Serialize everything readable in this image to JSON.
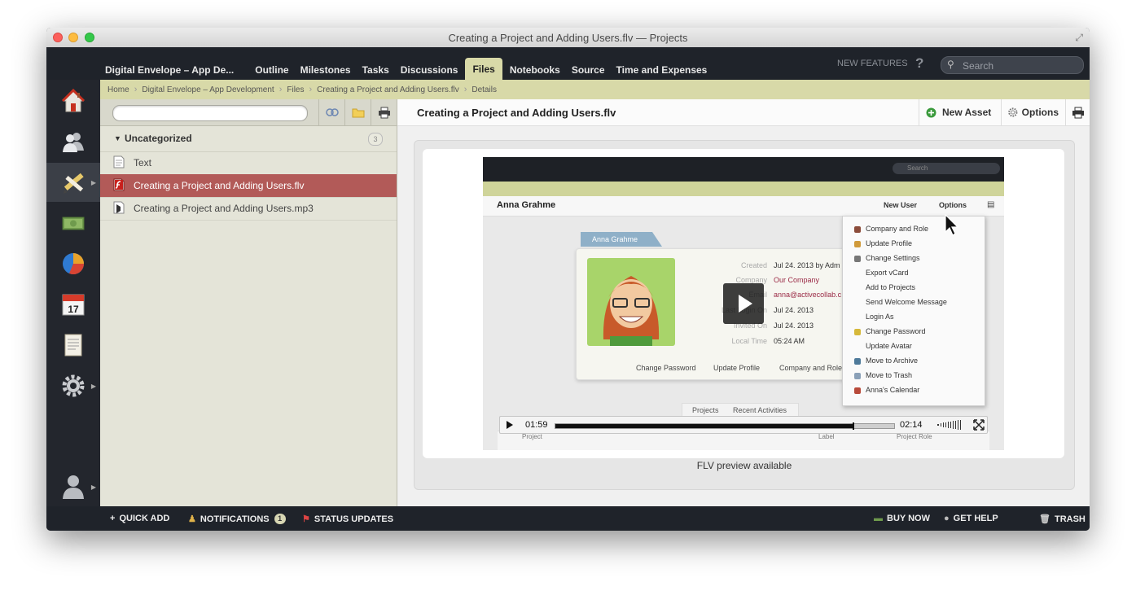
{
  "window": {
    "title": "Creating a Project and Adding Users.flv — Projects"
  },
  "topnav": {
    "tabs": [
      {
        "label": "Digital Envelope – App De..."
      },
      {
        "label": "Outline"
      },
      {
        "label": "Milestones"
      },
      {
        "label": "Tasks"
      },
      {
        "label": "Discussions"
      },
      {
        "label": "Files"
      },
      {
        "label": "Notebooks"
      },
      {
        "label": "Source"
      },
      {
        "label": "Time and Expenses"
      }
    ],
    "active_tab": "Files",
    "new_features": "NEW FEATURES",
    "help": "?",
    "search_placeholder": "Search"
  },
  "leftnav": {
    "items": [
      {
        "icon": "home-icon"
      },
      {
        "icon": "people-icon"
      },
      {
        "icon": "pencil-ruler-icon",
        "active": true
      },
      {
        "icon": "money-icon"
      },
      {
        "icon": "pie-chart-icon"
      },
      {
        "icon": "calendar-icon",
        "label": "17"
      },
      {
        "icon": "document-icon"
      },
      {
        "icon": "settings-gear-icon"
      },
      {
        "icon": "user-profile-icon"
      }
    ]
  },
  "breadcrumb": [
    "Home",
    "Digital Envelope – App Development",
    "Files",
    "Creating a Project and Adding Users.flv",
    "Details"
  ],
  "sidebar": {
    "group_name": "Uncategorized",
    "group_count": "3",
    "files": [
      {
        "name": "Text",
        "icon": "text-file-icon"
      },
      {
        "name": "Creating a Project and Adding Users.flv",
        "icon": "flash-video-icon",
        "selected": true
      },
      {
        "name": "Creating a Project and Adding Users.mp3",
        "icon": "audio-file-icon"
      }
    ]
  },
  "main": {
    "title": "Creating a Project and Adding Users.flv",
    "new_asset": "New Asset",
    "options": "Options",
    "caption": "FLV preview available"
  },
  "video": {
    "current_time": "01:59",
    "duration": "02:14",
    "progress": 0.88,
    "frame": {
      "search": "Search",
      "user_name": "Anna Grahme",
      "new_user": "New User",
      "options": "Options",
      "card_tab": "Anna Grahme",
      "details": [
        {
          "label": "Created",
          "value": "Jul 24. 2013 by Adm"
        },
        {
          "label": "Company",
          "value": "Our Company"
        },
        {
          "label": "Email",
          "value": "anna@activecollab.c"
        },
        {
          "label": "Last Login On",
          "value": "Jul 24. 2013"
        },
        {
          "label": "Invited On",
          "value": "Jul 24. 2013"
        },
        {
          "label": "Local Time",
          "value": "05:24 AM"
        }
      ],
      "card_links": [
        "Change Password",
        "Update Profile",
        "Company and Role"
      ],
      "menu": [
        "Company and Role",
        "Update Profile",
        "Change Settings",
        "Export vCard",
        "Add to Projects",
        "Send Welcome Message",
        "Login As",
        "Change Password",
        "Update Avatar",
        "Move to Archive",
        "Move to Trash",
        "Anna's Calendar"
      ],
      "subtabs": [
        "Projects",
        "Recent Activities"
      ],
      "table_headers": [
        "Project",
        "Label",
        "Project Role"
      ]
    }
  },
  "bottombar": {
    "quick_add": "QUICK ADD",
    "notifications": "NOTIFICATIONS",
    "notifications_count": "1",
    "status_updates": "STATUS UPDATES",
    "buy_now": "BUY NOW",
    "get_help": "GET HELP",
    "trash": "TRASH"
  }
}
